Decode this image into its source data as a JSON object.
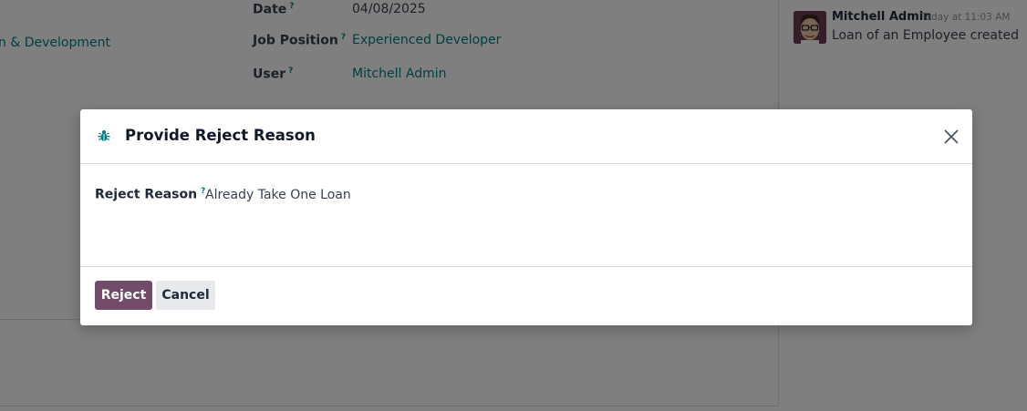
{
  "background": {
    "left_link_partial": "n & Development",
    "fields": [
      {
        "label": "Date",
        "help": "?",
        "value": "04/08/2025"
      },
      {
        "label": "Job Position",
        "help": "?",
        "value": "Experienced Developer"
      },
      {
        "label": "User",
        "help": "?",
        "value": "Mitchell Admin"
      }
    ]
  },
  "chatter": {
    "author": "Mitchell Admin",
    "time": "Today at 11:03 AM",
    "body": "Loan of an Employee created"
  },
  "dialog": {
    "title": "Provide Reject Reason",
    "reason_label": "Reject Reason",
    "reason_help": "?",
    "reason_value": "Already Take One Loan",
    "reject_label": "Reject",
    "cancel_label": "Cancel"
  },
  "colors": {
    "primary": "#714b67",
    "link": "#017e84",
    "overlay": "rgba(0,0,0,0.5)"
  },
  "icons": {
    "title_icon": "bug-icon",
    "close_icon": "close-icon"
  }
}
